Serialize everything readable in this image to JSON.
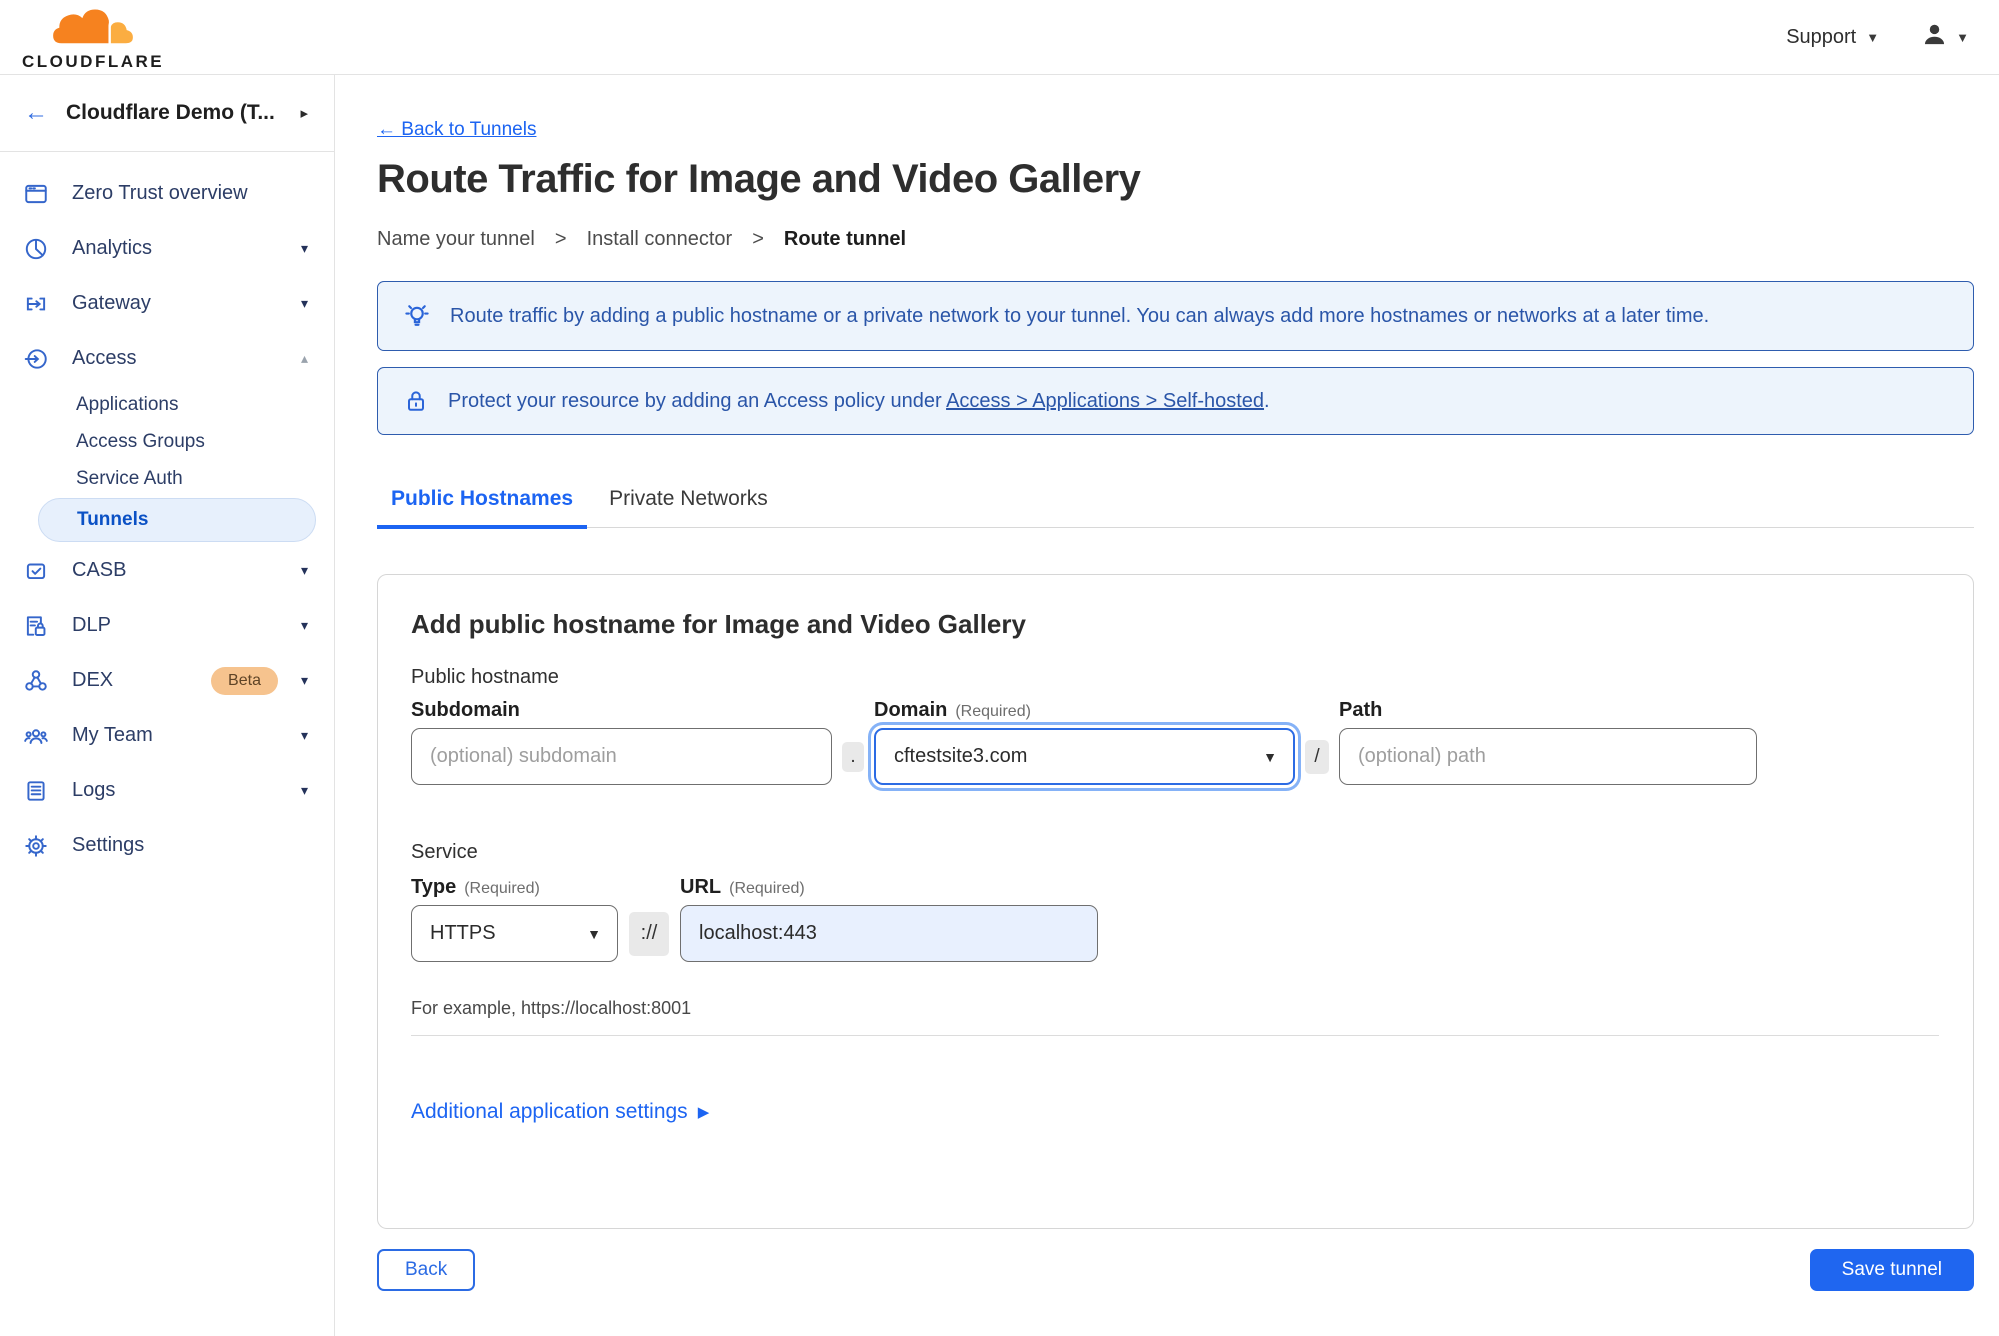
{
  "icons": {
    "caret_down": "▼",
    "chev_down": "▾",
    "chev_up": "▴",
    "chev_right": "▸",
    "play_right": "▶",
    "arrow_left": "←",
    "gt": ">"
  },
  "topbar": {
    "logo_word": "CLOUDFLARE",
    "support_label": "Support"
  },
  "sidebar": {
    "account_name": "Cloudflare Demo (T...",
    "overview": "Zero Trust overview",
    "analytics": "Analytics",
    "gateway": "Gateway",
    "access": "Access",
    "applications": "Applications",
    "access_groups": "Access Groups",
    "service_auth": "Service Auth",
    "tunnels": "Tunnels",
    "casb": "CASB",
    "dlp": "DLP",
    "dex": "DEX",
    "dex_badge": "Beta",
    "my_team": "My Team",
    "logs": "Logs",
    "settings": "Settings"
  },
  "main": {
    "back_link": "← Back to Tunnels",
    "title": "Route Traffic for Image and Video Gallery",
    "steps": {
      "step1": "Name your tunnel",
      "step2": "Install connector",
      "step3": "Route tunnel"
    },
    "banner_tip": "Route traffic by adding a public hostname or a private network to your tunnel. You can always add more hostnames or networks at a later time.",
    "banner_protect_prefix": "Protect your resource by adding an Access policy under",
    "banner_protect_link": "Access > Applications > Self-hosted",
    "banner_protect_suffix": ".",
    "tabs": {
      "public_hostnames": "Public Hostnames",
      "private_networks": "Private Networks"
    },
    "form": {
      "heading": "Add public hostname for Image and Video Gallery",
      "public_hostname_label": "Public hostname",
      "subdomain_label": "Subdomain",
      "subdomain_placeholder": "(optional) subdomain",
      "dot_separator": ".",
      "domain_label": "Domain",
      "required_label": "(Required)",
      "domain_value": "cftestsite3.com",
      "slash_separator": "/",
      "path_label": "Path",
      "path_placeholder": "(optional) path",
      "service_label": "Service",
      "type_label": "Type",
      "type_value": "HTTPS",
      "scheme_separator": "://",
      "url_label": "URL",
      "url_value": "localhost:443",
      "example_text": "For example, https://localhost:8001",
      "additional_settings_label": "Additional application settings"
    },
    "footer": {
      "back_label": "Back",
      "save_label": "Save tunnel"
    }
  },
  "colors": {
    "accent": "#1c64f2",
    "banner_border": "#2e5cae",
    "banner_bg": "#edf4fc",
    "banner_text": "#2a55a8",
    "sidebar_icon": "#3566cb",
    "selected_pill_bg": "#e7f0fc",
    "selected_pill_text": "#0b51c5",
    "beta_badge_bg": "#f6c38e",
    "url_field_fill": "#e8f0fe",
    "logo_orange": "#F6821F",
    "logo_orange_light": "#FBAD41"
  }
}
